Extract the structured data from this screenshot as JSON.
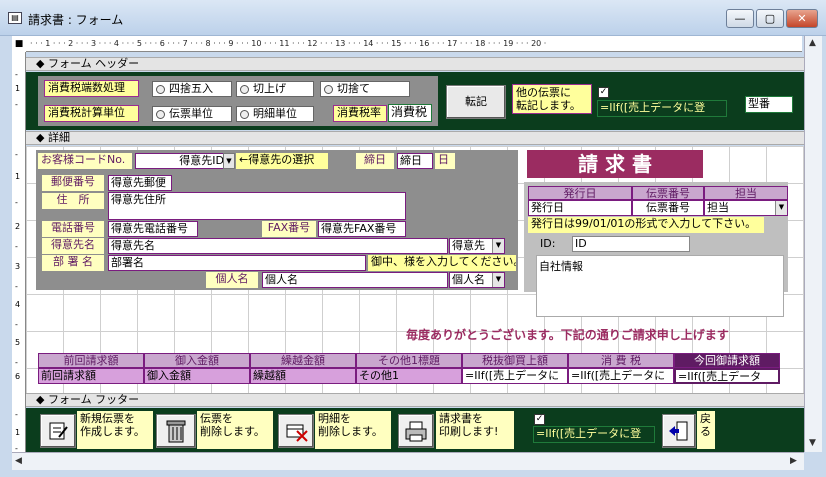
{
  "window": {
    "title": "請求書 : フォーム",
    "title_icon": "form-icon",
    "minimize": "—",
    "maximize": "▢",
    "close": "✕"
  },
  "ruler": {
    "marks": "· · · 1 · · · 2 · · · 3 · · · 4 · · · 5 · · · 6 · · · 7 · · · 8 · · · 9 · · · 10 · · · 11 · · · 12 · · · 13 · · · 14 · · · 15 · · · 16 · · · 17 · · · 18 · · · 19 · · · 20 ·",
    "vmarks": [
      "-",
      "1",
      "-",
      "-",
      "1",
      "-",
      "2",
      "-",
      "3",
      "-",
      "4",
      "-",
      "5",
      "-",
      "6",
      "-",
      "1",
      "-"
    ]
  },
  "sections": {
    "header": "フォーム ヘッダー",
    "detail": "詳細",
    "footer": "フォーム フッター"
  },
  "header": {
    "rounding_label": "消費税端数処理",
    "calc_unit_label": "消費税計算単位",
    "rounding_options": [
      "四捨五入",
      "切上げ",
      "切捨て"
    ],
    "unit_options": [
      "伝票単位",
      "明細単位"
    ],
    "tax_rate_label": "消費税率",
    "tax_rate_value": "消費税",
    "transfer_button": "転記",
    "transfer_note": "他の伝票に\n転記します。",
    "transfer_check": "✓",
    "transfer_formula": "=IIf([売上データに登",
    "model_field": "型番"
  },
  "detail": {
    "customer_code_label": "お客様コードNo.",
    "customer_id_field": "得意先ID",
    "customer_select_hint": "←得意先の選択",
    "closing_label": "締日",
    "closing_field": "締日",
    "closing_suffix": "日",
    "title": "請 求 書",
    "postal_label": "郵便番号",
    "postal_field": "得意先郵便",
    "address_label": "住　所",
    "address_field": "得意先住所",
    "phone_label": "電話番号",
    "phone_field": "得意先電話番号",
    "fax_label": "FAX番号",
    "fax_field": "得意先FAX番号",
    "customer_name_label": "得意先名",
    "customer_name_field": "得意先名",
    "customer_name_dd": "得意先",
    "dept_label": "部 署 名",
    "dept_field": "部署名",
    "dept_hint": "御中、様を入力してください。",
    "person_label": "個人名",
    "person_field": "個人名",
    "person_dd": "個人名",
    "issue_headers": [
      "発行日",
      "伝票番号",
      "担当"
    ],
    "issue_values": [
      "発行日",
      "伝票番号",
      "担当"
    ],
    "issue_hint": "発行日は99/01/01の形式で入力して下さい。",
    "id_label": "ID:",
    "id_field": "ID",
    "company_info": "自社情報",
    "thanks": "毎度ありがとうございます。下記の通りご請求申し上げます",
    "summary_headers": [
      "前回請求額",
      "御入金額",
      "繰越金額",
      "その他1標題",
      "税抜御買上額",
      "消 費 税",
      "今回御請求額"
    ],
    "summary_values": [
      "前回請求額",
      "御入金額",
      "繰越額",
      "その他1",
      "=IIf([売上データに",
      "=IIf([売上データに",
      "=IIf([売上データ"
    ]
  },
  "footer": {
    "new_note": "新規伝票を\n作成します。",
    "delete_slip_note": "伝票を\n削除します。",
    "delete_detail_note": "明細を\n削除します。",
    "print_note": "請求書を\n印刷します!",
    "check": "✓",
    "formula": "=IIf([売上データに登",
    "back_note": "戻\nる"
  },
  "scroll": {
    "left": "◀",
    "right": "▶",
    "up": "▲",
    "down": "▼"
  },
  "colors": {
    "green_band": "#0b3d1d",
    "gray_panel": "#8e8e8e",
    "accent_purple": "#7a1c7f",
    "label_yellow": "#ffff9c",
    "title_bg": "#9b2c61"
  }
}
